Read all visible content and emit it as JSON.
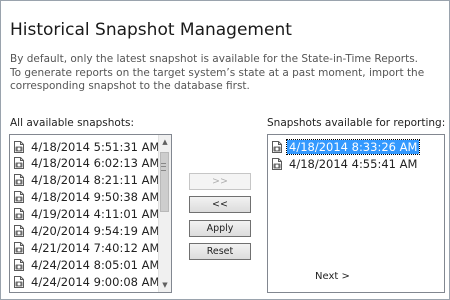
{
  "title": "Historical Snapshot Management",
  "description": [
    "By default, only the latest snapshot is available for the State-in-Time Reports.",
    "To generate reports on the target system’s state at a past moment, import the",
    "corresponding snapshot to the database first."
  ],
  "all_snapshots": {
    "label": "All available snapshots:",
    "items": [
      "4/18/2014 5:51:31 AM",
      "4/18/2014 6:02:13 AM",
      "4/18/2014 8:21:11 AM",
      "4/18/2014 9:50:38 AM",
      "4/19/2014 4:11:01 AM",
      "4/20/2014 9:54:19 AM",
      "4/21/2014 7:40:12 AM",
      "4/24/2014 8:05:01 AM",
      "4/24/2014 9:00:08 AM"
    ]
  },
  "reporting_snapshots": {
    "label": "Snapshots available for reporting:",
    "items": [
      "4/18/2014 8:33:26 AM",
      "4/18/2014 4:55:41 AM"
    ],
    "selected_index": 0
  },
  "buttons": {
    "move_right": ">>",
    "move_left": "<<",
    "apply": "Apply",
    "reset": "Reset"
  },
  "next_label": "Next >",
  "icons": {
    "snapshot": "snapshot-icon"
  },
  "colors": {
    "selection": "#3399ff"
  }
}
